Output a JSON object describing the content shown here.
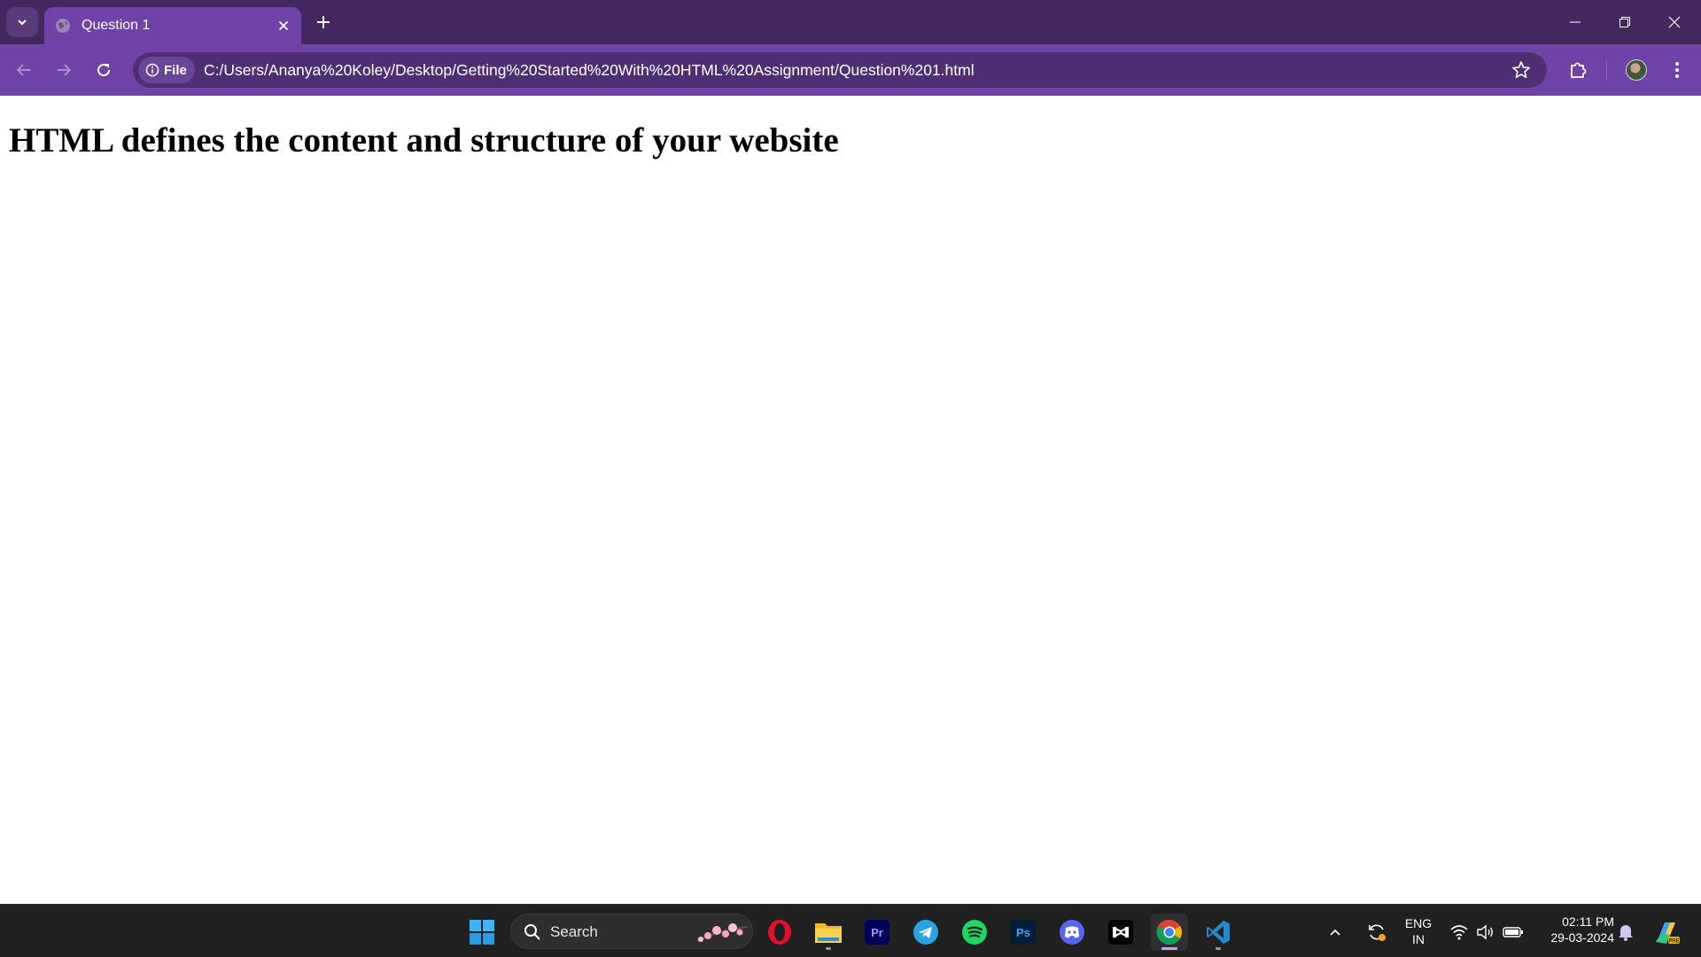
{
  "browser": {
    "tab": {
      "title": "Question 1"
    },
    "address": {
      "chip_label": "File",
      "url": "C:/Users/Ananya%20Koley/Desktop/Getting%20Started%20With%20HTML%20Assignment/Question%201.html"
    },
    "colors": {
      "tabstrip": "#43275f",
      "toolbar": "#6f42a8",
      "omnibox": "#4e2f73"
    }
  },
  "page": {
    "heading": "HTML defines the content and structure of your website"
  },
  "taskbar": {
    "search_label": "Search",
    "apps": [
      "windows-start",
      "opera",
      "file-explorer",
      "premiere-pro",
      "telegram",
      "spotify",
      "photoshop",
      "discord",
      "capcut",
      "chrome",
      "vscode"
    ],
    "language": {
      "line1": "ENG",
      "line2": "IN"
    },
    "clock": {
      "time": "02:11 PM",
      "date": "29-03-2024"
    }
  }
}
